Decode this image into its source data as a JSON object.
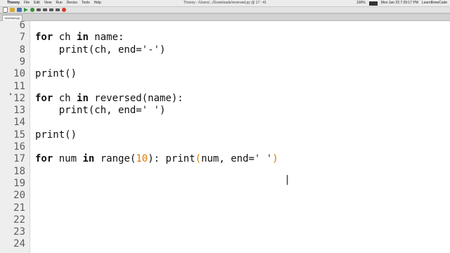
{
  "menubar": {
    "app_name": "Thonny",
    "menus": [
      "File",
      "Edit",
      "View",
      "Run",
      "Device",
      "Tools",
      "Help"
    ],
    "window_title": "Thonny - /Users/.../Downloads/reversed.py @ 17 : 41",
    "status_right": [
      "100%",
      "Mon Jan 23 7:29:17 PM",
      "LearnBrewCode"
    ]
  },
  "toolbar": {
    "buttons": [
      "new-file",
      "open-file",
      "save-file",
      "run",
      "debug",
      "step-over",
      "step-into",
      "step-out",
      "resume",
      "stop"
    ]
  },
  "tab": {
    "label": "reversed.py"
  },
  "editor": {
    "lines": [
      {
        "n": "6",
        "parts": []
      },
      {
        "n": "7",
        "parts": [
          [
            "kw",
            "for"
          ],
          [
            "t",
            " ch "
          ],
          [
            "kw",
            "in"
          ],
          [
            "t",
            " name:"
          ]
        ]
      },
      {
        "n": "8",
        "parts": [
          [
            "t",
            "    print(ch, end="
          ],
          [
            "s",
            "'-'"
          ],
          [
            "t",
            ")"
          ]
        ]
      },
      {
        "n": "9",
        "parts": []
      },
      {
        "n": "10",
        "parts": [
          [
            "t",
            "print()"
          ]
        ]
      },
      {
        "n": "11",
        "parts": []
      },
      {
        "n": "12",
        "parts": [
          [
            "kw",
            "for"
          ],
          [
            "t",
            " ch "
          ],
          [
            "kw",
            "in"
          ],
          [
            "t",
            " reversed(name):"
          ]
        ]
      },
      {
        "n": "13",
        "parts": [
          [
            "t",
            "    print(ch, end="
          ],
          [
            "s",
            "' '"
          ],
          [
            "t",
            ")"
          ]
        ]
      },
      {
        "n": "14",
        "parts": []
      },
      {
        "n": "15",
        "parts": [
          [
            "t",
            "print()"
          ]
        ]
      },
      {
        "n": "16",
        "parts": []
      },
      {
        "n": "17",
        "parts": [
          [
            "kw",
            "for"
          ],
          [
            "t",
            " num "
          ],
          [
            "kw",
            "in"
          ],
          [
            "t",
            " range("
          ],
          [
            "num",
            "10"
          ],
          [
            "t",
            "): print"
          ],
          [
            "p",
            "("
          ],
          [
            "t",
            "num, end="
          ],
          [
            "s",
            "' '"
          ],
          [
            "p",
            ")"
          ]
        ]
      },
      {
        "n": "18",
        "parts": []
      },
      {
        "n": "19",
        "parts": []
      },
      {
        "n": "20",
        "parts": []
      },
      {
        "n": "21",
        "parts": []
      },
      {
        "n": "22",
        "parts": []
      },
      {
        "n": "23",
        "parts": []
      },
      {
        "n": "24",
        "parts": []
      }
    ]
  }
}
